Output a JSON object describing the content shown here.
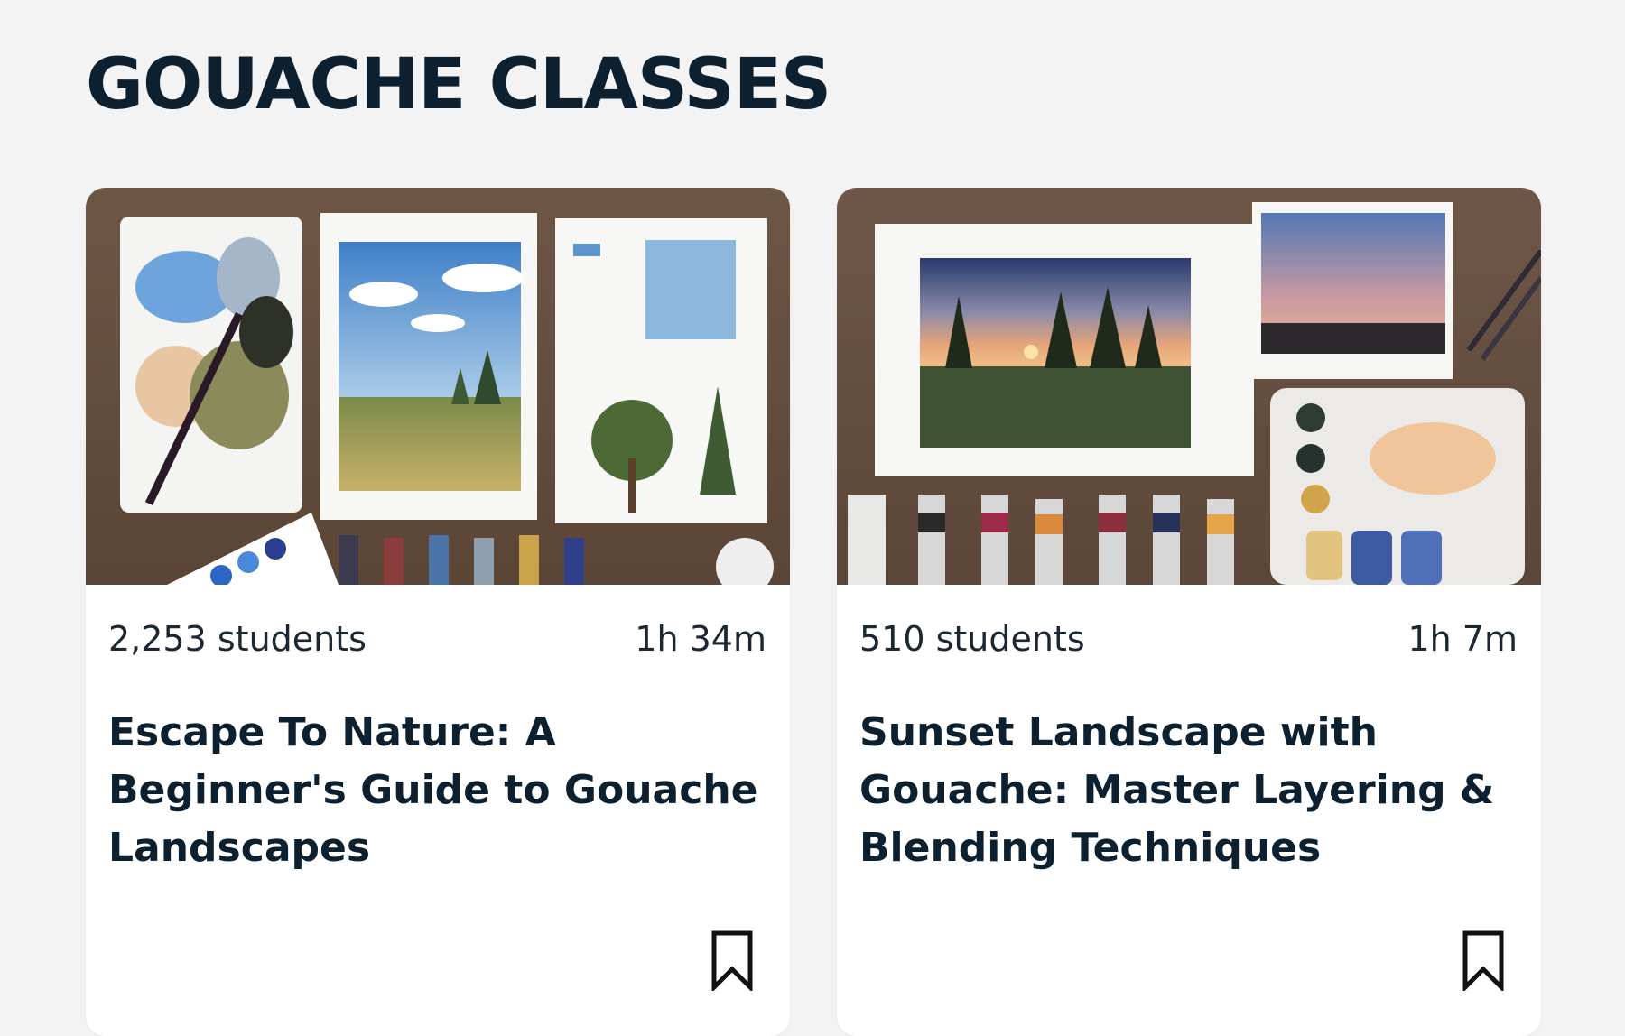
{
  "page": {
    "title": "GOUACHE CLASSES"
  },
  "cards": [
    {
      "students": "2,253 students",
      "duration": "1h 34m",
      "title": "Escape To Nature: A Beginner's Guide to Gouache Landscapes",
      "bookmark_icon": "bookmark-icon"
    },
    {
      "students": "510 students",
      "duration": "1h 7m",
      "title": "Sunset Landscape with Gouache: Master Layering & Blending Techniques",
      "bookmark_icon": "bookmark-icon"
    }
  ],
  "colors": {
    "background": "#f3f3f3",
    "card": "#ffffff",
    "title_text": "#0c2030",
    "body_text": "#1b2733"
  }
}
